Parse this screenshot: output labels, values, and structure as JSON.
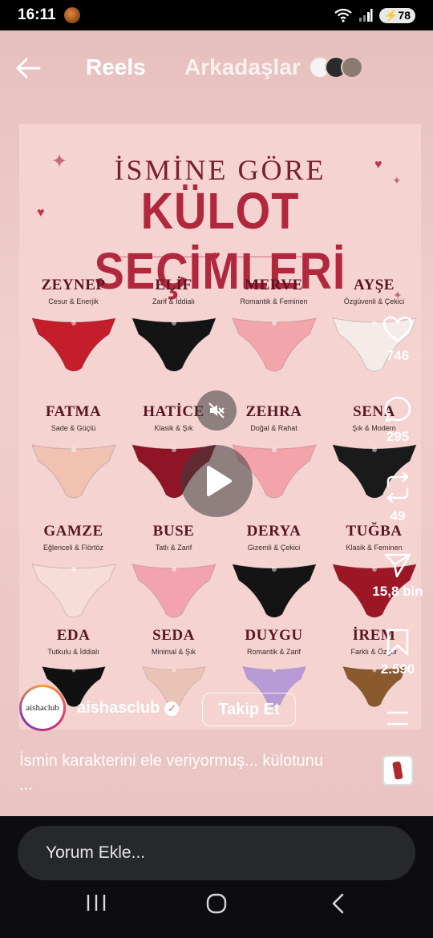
{
  "status": {
    "time": "16:11",
    "battery": "78"
  },
  "nav": {
    "title": "Reels",
    "friends": "Arkadaşlar"
  },
  "poster": {
    "subtitle": "İSMİNE GÖRE",
    "title": "KÜLOT SEÇİMLERİ",
    "items": [
      {
        "name": "ZEYNEP",
        "trait": "Cesur & Enerjik",
        "color": "#c41d2c"
      },
      {
        "name": "ELİF",
        "trait": "Zarif & İddialı",
        "color": "#141414"
      },
      {
        "name": "MERVE",
        "trait": "Romantik & Feminen",
        "color": "#f2a6ab"
      },
      {
        "name": "AYŞE",
        "trait": "Özgüvenli & Çekici",
        "color": "#f5ecea"
      },
      {
        "name": "FATMA",
        "trait": "Sade & Güçlü",
        "color": "#efc2b2"
      },
      {
        "name": "HATİCE",
        "trait": "Klasik & Şık",
        "color": "#8e1426"
      },
      {
        "name": "ZEHRA",
        "trait": "Doğal & Rahat",
        "color": "#f5a3aa"
      },
      {
        "name": "SENA",
        "trait": "Şık & Modern",
        "color": "#1a1a1a"
      },
      {
        "name": "GAMZE",
        "trait": "Eğlenceli & Flörtöz",
        "color": "#f7dcd8"
      },
      {
        "name": "BUSE",
        "trait": "Tatlı & Zarif",
        "color": "#f2a3ad"
      },
      {
        "name": "DERYA",
        "trait": "Gizemli & Çekici",
        "color": "#141414"
      },
      {
        "name": "TUĞBA",
        "trait": "Klasik & Feminen",
        "color": "#9c1626"
      },
      {
        "name": "EDA",
        "trait": "Tutkulu & İddialı",
        "color": "#111111"
      },
      {
        "name": "SEDA",
        "trait": "Minimal & Şık",
        "color": "#e9c3b6"
      },
      {
        "name": "DUYGU",
        "trait": "Romantik & Zarif",
        "color": "#b79ad6"
      },
      {
        "name": "İREM",
        "trait": "Farklı & Özgür",
        "color": "#8a5a2e"
      }
    ]
  },
  "actions": {
    "likes": "746",
    "comments": "295",
    "reposts": "49",
    "shares": "15,8 bin",
    "saves": "2.590"
  },
  "account": {
    "username": "aishasclub",
    "logo_text": "aishaclub",
    "follow_label": "Takip Et"
  },
  "caption": {
    "line1": "İsmin karakterini ele veriyormuş... külotunu",
    "line2": "..."
  },
  "comment": {
    "placeholder": "Yorum Ekle..."
  }
}
